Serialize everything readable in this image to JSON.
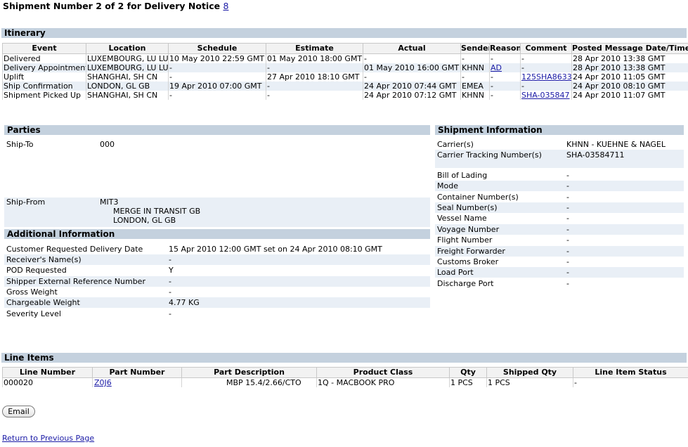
{
  "header": {
    "title_prefix": "Shipment Number 2 of 2 for Delivery Notice",
    "notice_number": "8"
  },
  "itinerary": {
    "section_title": "Itinerary",
    "columns": [
      "Event",
      "Location",
      "Schedule",
      "Estimate",
      "Actual",
      "Sender",
      "Reason",
      "Comment",
      "Posted Message Date/Time"
    ],
    "rows": [
      {
        "event": "Delivered",
        "location": "LUXEMBOURG, LU LU",
        "schedule": "10 May 2010 22:59 GMT",
        "estimate": "01 May 2010 18:00 GMT",
        "actual": "-",
        "sender": "-",
        "reason": "-",
        "comment": "-",
        "posted": "28 Apr 2010 13:38 GMT"
      },
      {
        "event": "Delivery Appointment",
        "location": "LUXEMBOURG, LU LU",
        "schedule": "-",
        "estimate": "-",
        "actual": "01 May 2010 16:00 GMT",
        "sender": "KHNN",
        "reason": "AD",
        "comment": "-",
        "posted": "28 Apr 2010 13:38 GMT"
      },
      {
        "event": "Uplift",
        "location": "SHANGHAI, SH CN",
        "schedule": "-",
        "estimate": "27 Apr 2010 18:10 GMT",
        "actual": "-",
        "sender": "-",
        "reason": "-",
        "comment": "125SHA8633",
        "posted": "24 Apr 2010 11:05 GMT"
      },
      {
        "event": "Ship Confirmation",
        "location": "LONDON, GL GB",
        "schedule": "19 Apr 2010 07:00 GMT",
        "estimate": "-",
        "actual": "24 Apr 2010 07:44 GMT",
        "sender": "EMEA",
        "reason": "-",
        "comment": "-",
        "posted": "24 Apr 2010 08:10 GMT"
      },
      {
        "event": "Shipment Picked Up",
        "location": "SHANGHAI, SH CN",
        "schedule": "-",
        "estimate": "-",
        "actual": "24 Apr 2010 07:12 GMT",
        "sender": "KHNN",
        "reason": "-",
        "comment": "SHA-035847",
        "posted": "24 Apr 2010 11:07 GMT"
      }
    ]
  },
  "parties": {
    "section_title": "Parties",
    "ship_to_label": "Ship-To",
    "ship_to_value": "000",
    "ship_from_label": "Ship-From",
    "ship_from_code": "MIT3",
    "ship_from_line1": "MERGE IN TRANSIT GB",
    "ship_from_line2": "LONDON, GL GB"
  },
  "additional": {
    "section_title": "Additional Information",
    "rows": [
      {
        "label": "Customer Requested Delivery Date",
        "value": "15 Apr 2010 12:00 GMT set on 24 Apr 2010 08:10 GMT"
      },
      {
        "label": "Receiver's Name(s)",
        "value": "-"
      },
      {
        "label": "POD Requested",
        "value": "Y"
      },
      {
        "label": "Shipper External Reference Number",
        "value": "-"
      },
      {
        "label": "Gross Weight",
        "value": "-"
      },
      {
        "label": "Chargeable Weight",
        "value": "4.77 KG"
      },
      {
        "label": "Severity Level",
        "value": "-"
      }
    ]
  },
  "shipment_info": {
    "section_title": "Shipment Information",
    "rows": [
      {
        "label": "Carrier(s)",
        "value": "KHNN - KUEHNE & NAGEL"
      },
      {
        "label": "Carrier Tracking Number(s)",
        "value": "SHA-03584711"
      },
      {
        "label": "Bill of Lading",
        "value": "-"
      },
      {
        "label": "Mode",
        "value": "-"
      },
      {
        "label": "Container Number(s)",
        "value": "-"
      },
      {
        "label": "Seal Number(s)",
        "value": "-"
      },
      {
        "label": "Vessel Name",
        "value": "-"
      },
      {
        "label": "Voyage Number",
        "value": "-"
      },
      {
        "label": "Flight Number",
        "value": "-"
      },
      {
        "label": "Freight Forwarder",
        "value": "-"
      },
      {
        "label": "Customs Broker",
        "value": "-"
      },
      {
        "label": "Load Port",
        "value": "-"
      },
      {
        "label": "Discharge Port",
        "value": "-"
      }
    ]
  },
  "line_items": {
    "section_title": "Line Items",
    "columns": [
      "Line Number",
      "Part Number",
      "Part Description",
      "Product Class",
      "Qty",
      "Shipped Qty",
      "Line Item Status"
    ],
    "rows": [
      {
        "line_number": "000020",
        "part_number": "Z0J6",
        "part_description": "MBP 15.4/2.66/CTO",
        "product_class": "1Q - MACBOOK PRO",
        "qty": "1 PCS",
        "shipped_qty": "1 PCS",
        "status": "-"
      }
    ]
  },
  "actions": {
    "email_label": "Email",
    "return_label": "Return to Previous Page"
  }
}
